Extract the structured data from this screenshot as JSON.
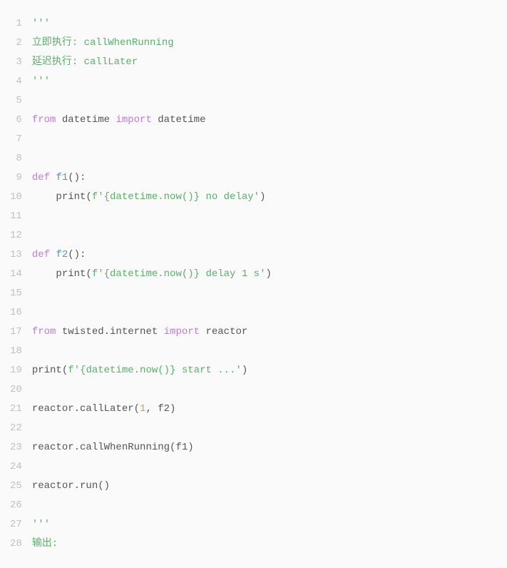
{
  "lines": {
    "l1": {
      "t": "'''",
      "cls": "tok-str"
    },
    "l2": {
      "t": "立即执行: callWhenRunning",
      "cls": "tok-str"
    },
    "l3": {
      "t": "延迟执行: callLater",
      "cls": "tok-str"
    },
    "l4": {
      "t": "'''",
      "cls": "tok-str"
    },
    "l5": {
      "t": "",
      "cls": ""
    },
    "l6a": {
      "t": "from",
      "cls": "tok-kw"
    },
    "l6b": {
      "t": " datetime ",
      "cls": ""
    },
    "l6c": {
      "t": "import",
      "cls": "tok-kw"
    },
    "l6d": {
      "t": " datetime",
      "cls": ""
    },
    "l7": {
      "t": "",
      "cls": ""
    },
    "l8": {
      "t": "",
      "cls": ""
    },
    "l9a": {
      "t": "def",
      "cls": "tok-kw"
    },
    "l9b": {
      "t": " ",
      "cls": ""
    },
    "l9c": {
      "t": "f1",
      "cls": "tok-def"
    },
    "l9d": {
      "t": "():",
      "cls": ""
    },
    "l10a": {
      "t": "    print(",
      "cls": ""
    },
    "l10b": {
      "t": "f'{datetime.now()} no delay'",
      "cls": "tok-str"
    },
    "l10c": {
      "t": ")",
      "cls": ""
    },
    "l11": {
      "t": "",
      "cls": ""
    },
    "l12": {
      "t": "",
      "cls": ""
    },
    "l13a": {
      "t": "def",
      "cls": "tok-kw"
    },
    "l13b": {
      "t": " ",
      "cls": ""
    },
    "l13c": {
      "t": "f2",
      "cls": "tok-def"
    },
    "l13d": {
      "t": "():",
      "cls": ""
    },
    "l14a": {
      "t": "    print(",
      "cls": ""
    },
    "l14b": {
      "t": "f'{datetime.now()} delay 1 s'",
      "cls": "tok-str"
    },
    "l14c": {
      "t": ")",
      "cls": ""
    },
    "l15": {
      "t": "",
      "cls": ""
    },
    "l16": {
      "t": "",
      "cls": ""
    },
    "l17a": {
      "t": "from",
      "cls": "tok-kw"
    },
    "l17b": {
      "t": " twisted.internet ",
      "cls": ""
    },
    "l17c": {
      "t": "import",
      "cls": "tok-kw"
    },
    "l17d": {
      "t": " reactor",
      "cls": ""
    },
    "l18": {
      "t": "",
      "cls": ""
    },
    "l19a": {
      "t": "print(",
      "cls": ""
    },
    "l19b": {
      "t": "f'{datetime.now()} start ...'",
      "cls": "tok-str"
    },
    "l19c": {
      "t": ")",
      "cls": ""
    },
    "l20": {
      "t": "",
      "cls": ""
    },
    "l21a": {
      "t": "reactor.callLater(",
      "cls": ""
    },
    "l21b": {
      "t": "1",
      "cls": "tok-num"
    },
    "l21c": {
      "t": ", f2)",
      "cls": ""
    },
    "l22": {
      "t": "",
      "cls": ""
    },
    "l23": {
      "t": "reactor.callWhenRunning(f1)",
      "cls": ""
    },
    "l24": {
      "t": "",
      "cls": ""
    },
    "l25": {
      "t": "reactor.run()",
      "cls": ""
    },
    "l26": {
      "t": "",
      "cls": ""
    },
    "l27": {
      "t": "'''",
      "cls": "tok-str"
    },
    "l28": {
      "t": "输出:",
      "cls": "tok-str"
    }
  },
  "numbers": {
    "n1": "1",
    "n2": "2",
    "n3": "3",
    "n4": "4",
    "n5": "5",
    "n6": "6",
    "n7": "7",
    "n8": "8",
    "n9": "9",
    "n10": "10",
    "n11": "11",
    "n12": "12",
    "n13": "13",
    "n14": "14",
    "n15": "15",
    "n16": "16",
    "n17": "17",
    "n18": "18",
    "n19": "19",
    "n20": "20",
    "n21": "21",
    "n22": "22",
    "n23": "23",
    "n24": "24",
    "n25": "25",
    "n26": "26",
    "n27": "27",
    "n28": "28"
  }
}
